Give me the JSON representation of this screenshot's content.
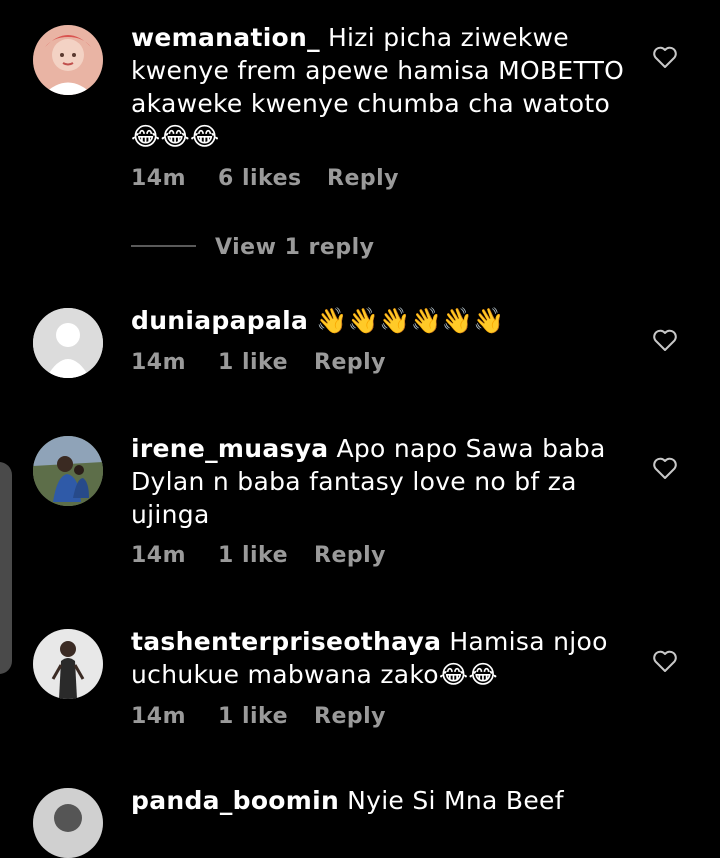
{
  "comments": [
    {
      "username": "wemanation_",
      "text": "Hizi picha ziwekwe kwenye frem apewe hamisa MOBETTO akaweke kwenye chumba cha watoto 😂😂😂",
      "time": "14m",
      "likes": "6 likes",
      "reply": "Reply",
      "view_replies": "View 1 reply"
    },
    {
      "username": "duniapapala",
      "text": "👋👋👋👋👋👋",
      "time": "14m",
      "likes": "1 like",
      "reply": "Reply"
    },
    {
      "username": "irene_muasya",
      "text": "Apo napo Sawa baba Dylan n baba fantasy love no bf za ujinga",
      "time": "14m",
      "likes": "1 like",
      "reply": "Reply"
    },
    {
      "username": "tashenterpriseothaya",
      "text": "Hamisa  njoo uchukue  mabwana zako😂😂",
      "time": "14m",
      "likes": "1 like",
      "reply": "Reply"
    },
    {
      "username": "panda_boomin",
      "text": "Nyie Si Mna Beef"
    }
  ],
  "colors": {
    "background": "#000000",
    "meta_text": "#9a9a9a",
    "text": "#ffffff"
  },
  "icons": [
    "heart-icon",
    "avatar-placeholder-icon"
  ]
}
